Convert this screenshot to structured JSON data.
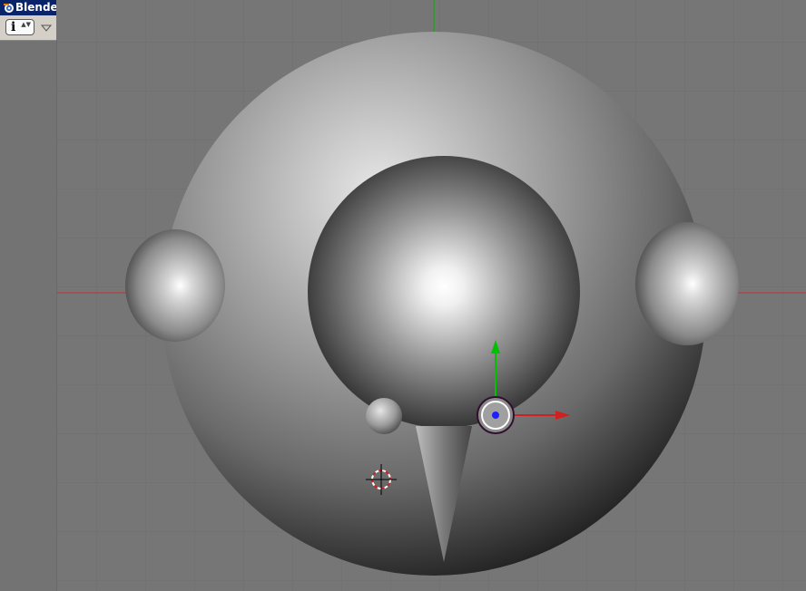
{
  "window": {
    "title": "Blender"
  },
  "header": {
    "info_button_label": "i",
    "info_button_arrows": "▲▼"
  },
  "icons": [
    "blender-logo-icon",
    "info-icon",
    "menu-arrow-icon",
    "3d-cursor-icon",
    "translate-manipulator-icon"
  ],
  "colors": {
    "axis_x": "#c43030",
    "axis_y": "#00b000",
    "title_bar": "#0a246a",
    "viewport_bg": "#767676"
  },
  "viewport": {
    "grid": true
  }
}
